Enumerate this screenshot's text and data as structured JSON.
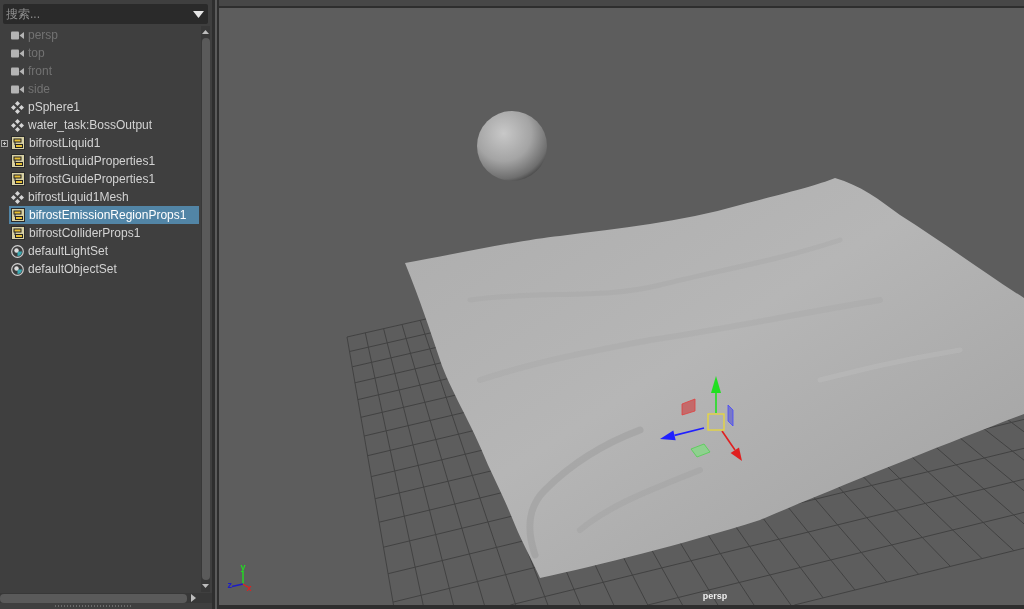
{
  "outliner": {
    "search": {
      "placeholder": "搜索..."
    },
    "items": [
      {
        "kind": "camera",
        "label": "persp",
        "disabled": true,
        "expandable": false,
        "selected": false
      },
      {
        "kind": "camera",
        "label": "top",
        "disabled": true,
        "expandable": false,
        "selected": false
      },
      {
        "kind": "camera",
        "label": "front",
        "disabled": true,
        "expandable": false,
        "selected": false
      },
      {
        "kind": "camera",
        "label": "side",
        "disabled": true,
        "expandable": false,
        "selected": false
      },
      {
        "kind": "transform",
        "label": "pSphere1",
        "disabled": false,
        "expandable": false,
        "selected": false
      },
      {
        "kind": "transform",
        "label": "water_task:BossOutput",
        "disabled": false,
        "expandable": false,
        "selected": false
      },
      {
        "kind": "node",
        "label": "bifrostLiquid1",
        "disabled": false,
        "expandable": true,
        "selected": false
      },
      {
        "kind": "node",
        "label": "bifrostLiquidProperties1",
        "disabled": false,
        "expandable": false,
        "selected": false
      },
      {
        "kind": "node",
        "label": "bifrostGuideProperties1",
        "disabled": false,
        "expandable": false,
        "selected": false
      },
      {
        "kind": "transform",
        "label": "bifrostLiquid1Mesh",
        "disabled": false,
        "expandable": false,
        "selected": false
      },
      {
        "kind": "node",
        "label": "bifrostEmissionRegionProps1",
        "disabled": false,
        "expandable": false,
        "selected": true
      },
      {
        "kind": "node",
        "label": "bifrostColliderProps1",
        "disabled": false,
        "expandable": false,
        "selected": false
      },
      {
        "kind": "set",
        "label": "defaultLightSet",
        "disabled": false,
        "expandable": false,
        "selected": false
      },
      {
        "kind": "set",
        "label": "defaultObjectSet",
        "disabled": false,
        "expandable": false,
        "selected": false
      }
    ]
  },
  "viewport": {
    "axis_labels": [
      {
        "label": "y",
        "color": "#22dd22"
      },
      {
        "label": "z",
        "color": "#1c1cc8"
      },
      {
        "label": "x",
        "color": "#e02020"
      }
    ],
    "camera_label": "persp"
  }
}
